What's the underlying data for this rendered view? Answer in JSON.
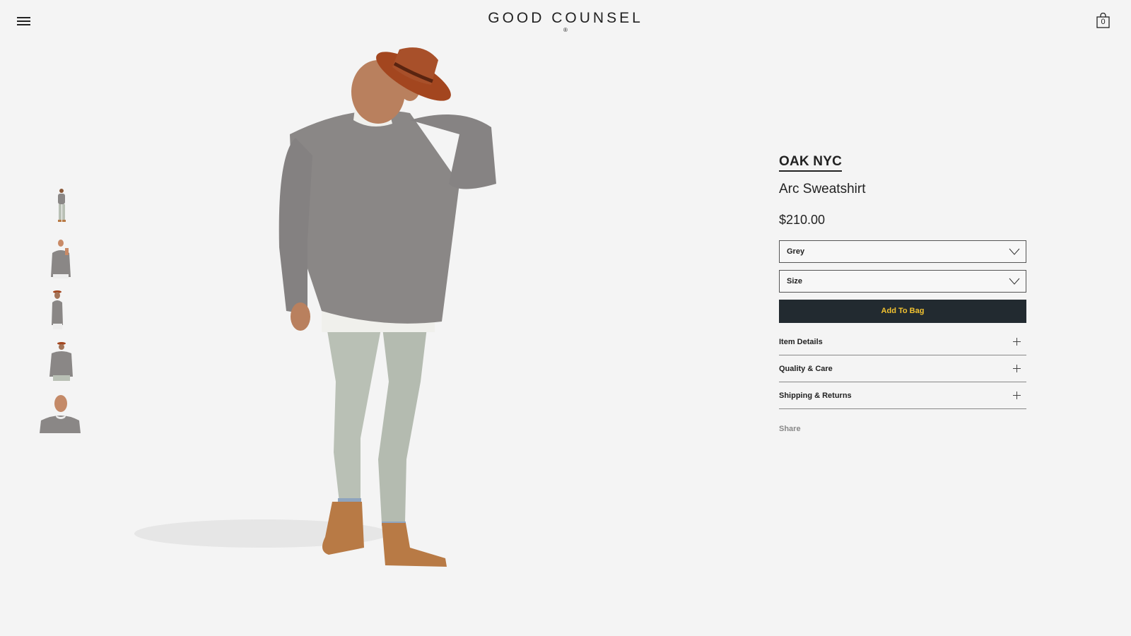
{
  "header": {
    "logo_text": "GOOD COUNSEL",
    "logo_mark": "®",
    "menu_icon": "hamburger-icon",
    "bag_icon": "shopping-bag-icon",
    "bag_count": "0"
  },
  "gallery": {
    "thumbnails": [
      {
        "label": "full-body-front"
      },
      {
        "label": "upper-body-front"
      },
      {
        "label": "side-profile"
      },
      {
        "label": "back-view"
      },
      {
        "label": "close-up"
      }
    ]
  },
  "product": {
    "brand": "OAK NYC",
    "name": "Arc Sweatshirt",
    "price": "$210.00",
    "color_select": "Grey",
    "size_select": "Size",
    "add_to_bag": "Add To Bag",
    "accordion": [
      {
        "label": "Item Details"
      },
      {
        "label": "Quality & Care"
      },
      {
        "label": "Shipping & Returns"
      }
    ],
    "share_label": "Share"
  },
  "colors": {
    "background": "#f4f4f4",
    "button_bg": "#222a30",
    "button_text": "#f2c230",
    "sweater": "#8a8786",
    "jeans": "#b9c0b5",
    "hat": "#a3461f",
    "boots": "#b87a45"
  }
}
